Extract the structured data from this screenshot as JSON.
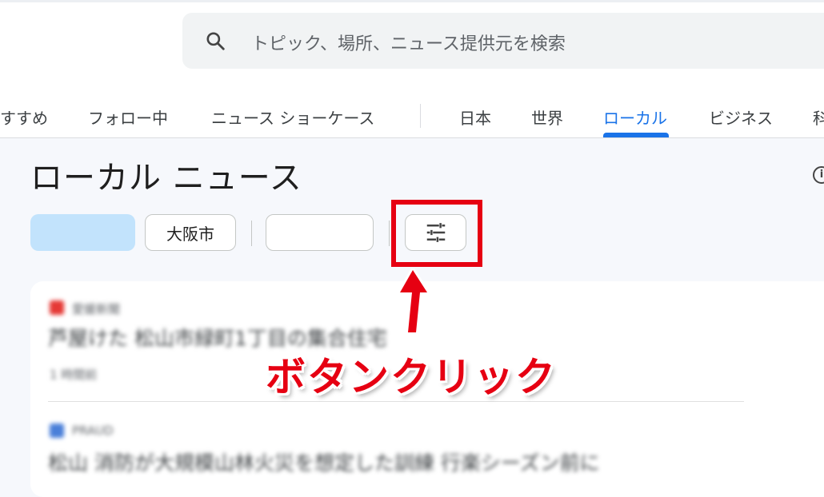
{
  "search": {
    "placeholder": "トピック、場所、ニュース提供元を検索",
    "icon": "search-icon"
  },
  "nav": {
    "items": [
      {
        "label": "すすめ",
        "active": false
      },
      {
        "label": "フォロー中",
        "active": false
      },
      {
        "label": "ニュース ショーケース",
        "active": false
      },
      {
        "label": "日本",
        "active": false
      },
      {
        "label": "世界",
        "active": false
      },
      {
        "label": "ローカル",
        "active": true
      },
      {
        "label": "ビジネス",
        "active": false
      },
      {
        "label": "科",
        "active": false
      }
    ],
    "accent_color": "#1a73e8"
  },
  "main": {
    "title": "ローカル ニュース",
    "info_icon": "info-icon",
    "chips": [
      {
        "label": "",
        "selected": true
      },
      {
        "label": "大阪市",
        "selected": false
      },
      {
        "label": "",
        "selected": false
      }
    ],
    "filter_button_icon": "tune-icon"
  },
  "cards": [
    {
      "source": "愛媛新聞",
      "headline": "芦屋けた 松山市緑町1丁目の集合住宅",
      "time": "1 時間前",
      "logo_color": "#e53935"
    },
    {
      "source": "PRAUD",
      "headline": "松山 消防が大規模山林火災を想定した訓練 行楽シーズン前に",
      "logo_color": "#4a7fd9"
    }
  ],
  "annotation": {
    "text": "ボタンクリック",
    "color": "#e60012"
  }
}
